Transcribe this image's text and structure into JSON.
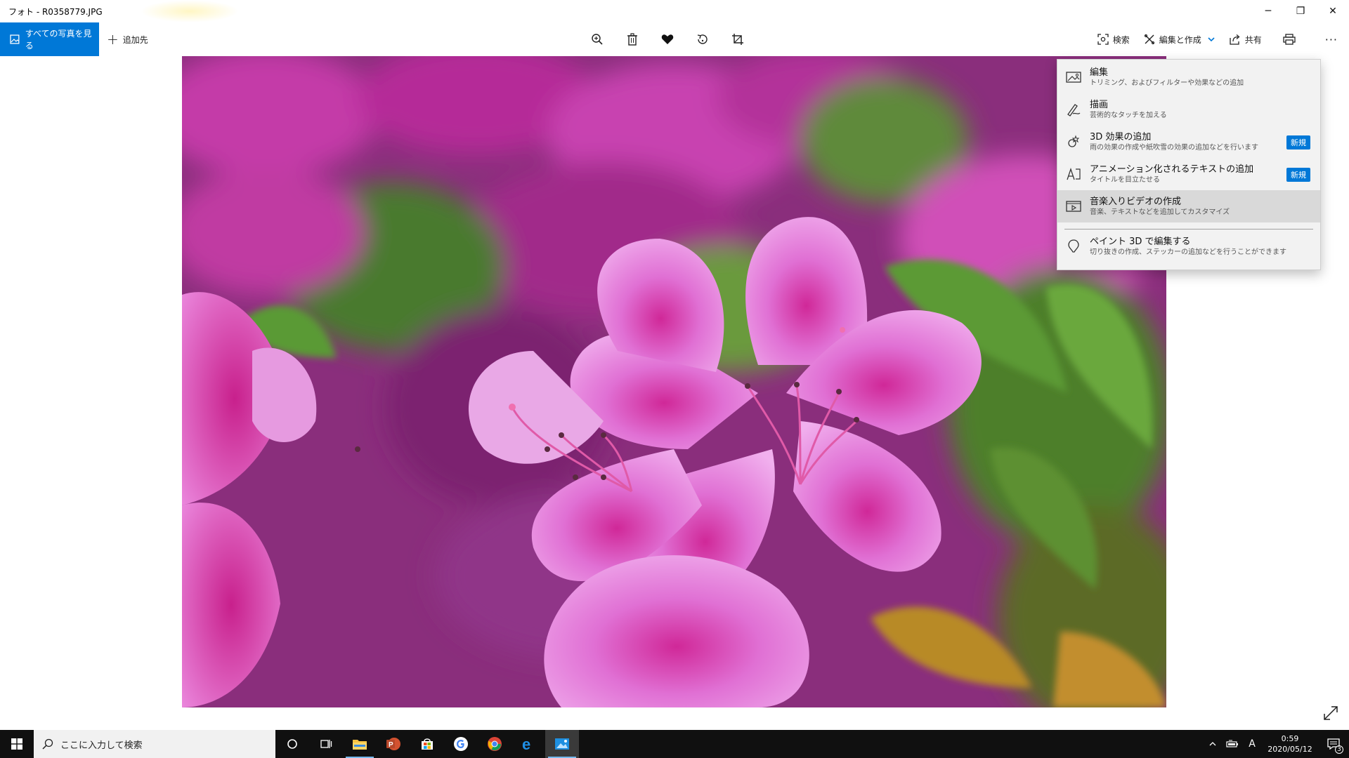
{
  "window": {
    "title": "フォト - R0358779.JPG",
    "controls": {
      "minimize": "─",
      "restore": "❐",
      "close": "✕"
    }
  },
  "toolbar": {
    "all_photos": "すべての写真を見る",
    "add_to": "追加先",
    "center_icons": [
      "zoom-icon",
      "delete-icon",
      "favorite-icon",
      "rotate-icon",
      "crop-icon"
    ],
    "search": "検索",
    "edit_create": "編集と作成",
    "share": "共有",
    "print_icon": "print-icon",
    "more": "···"
  },
  "menu": {
    "items": [
      {
        "title": "編集",
        "sub": "トリミング、およびフィルターや効果などの追加",
        "icon": "edit-image-icon"
      },
      {
        "title": "描画",
        "sub": "芸術的なタッチを加える",
        "icon": "draw-icon"
      },
      {
        "title": "3D 効果の追加",
        "sub": "雨の効果の作成や紙吹雪の効果の追加などを行います",
        "icon": "effects-3d-icon",
        "badge": "新規"
      },
      {
        "title": "アニメーション化されるテキストの追加",
        "sub": "タイトルを目立たせる",
        "icon": "animated-text-icon",
        "badge": "新規"
      },
      {
        "title": "音楽入りビデオの作成",
        "sub": "音楽、テキストなどを追加してカスタマイズ",
        "icon": "video-icon",
        "highlighted": true
      },
      {
        "title": "ペイント 3D で編集する",
        "sub": "切り抜きの作成、ステッカーの追加などを行うことができます",
        "icon": "paint3d-icon"
      }
    ]
  },
  "taskbar": {
    "search_placeholder": "ここに入力して検索",
    "apps": [
      "cortana-icon",
      "task-view-icon",
      "file-explorer-icon",
      "powerpoint-icon",
      "store-icon",
      "google-icon",
      "chrome-icon",
      "edge-icon",
      "photos-icon"
    ],
    "ime": "A",
    "time": "0:59",
    "date": "2020/05/12",
    "notification_count": "3"
  },
  "colors": {
    "accent": "#0078d7",
    "taskbar": "#101010",
    "menu_bg": "#f2f2f2"
  }
}
